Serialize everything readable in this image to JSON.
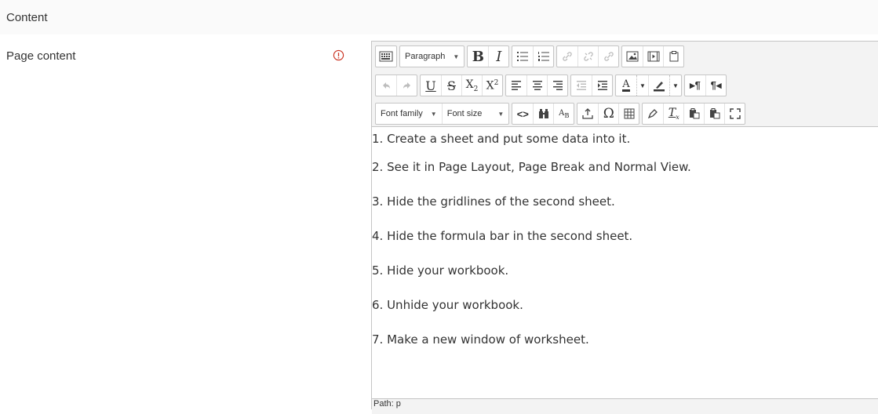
{
  "section": {
    "title": "Content"
  },
  "field": {
    "label": "Page content",
    "required_icon": "exclamation-circle-icon"
  },
  "toolbar": {
    "format_select": "Paragraph",
    "font_family_select": "Font family",
    "font_size_select": "Font size",
    "icons_row1": [
      "toggle-toolbar-icon",
      "bold-icon",
      "italic-icon",
      "bullet-list-icon",
      "numbered-list-icon",
      "link-icon",
      "unlink-icon",
      "anchor-icon",
      "image-icon",
      "media-icon",
      "paste-special-icon"
    ],
    "icons_row2": [
      "undo-icon",
      "redo-icon",
      "underline-icon",
      "strikethrough-icon",
      "subscript-icon",
      "superscript-icon",
      "align-left-icon",
      "align-center-icon",
      "align-right-icon",
      "outdent-icon",
      "indent-icon",
      "text-color-icon",
      "background-color-icon",
      "ltr-icon",
      "rtl-icon"
    ],
    "icons_row3": [
      "code-icon",
      "find-icon",
      "find-replace-icon",
      "insert-file-icon",
      "special-char-icon",
      "table-icon",
      "clear-format-icon",
      "remove-format-icon",
      "paste-text-icon",
      "paste-word-icon",
      "fullscreen-icon"
    ]
  },
  "content": {
    "lines": [
      "1. Create a sheet and put some data into it.",
      "2. See it in Page Layout, Page Break and Normal View.",
      "3. Hide the gridlines of the second sheet.",
      "4. Hide the formula bar in the second sheet.",
      "5. Hide your workbook.",
      "6. Unhide your workbook.",
      "7. Make a new window of worksheet."
    ]
  },
  "statusbar": {
    "path": "Path: p"
  },
  "colors": {
    "required": "#ca3120",
    "border": "#c5c5c5",
    "toolbar_bg": "#f3f3f3"
  }
}
